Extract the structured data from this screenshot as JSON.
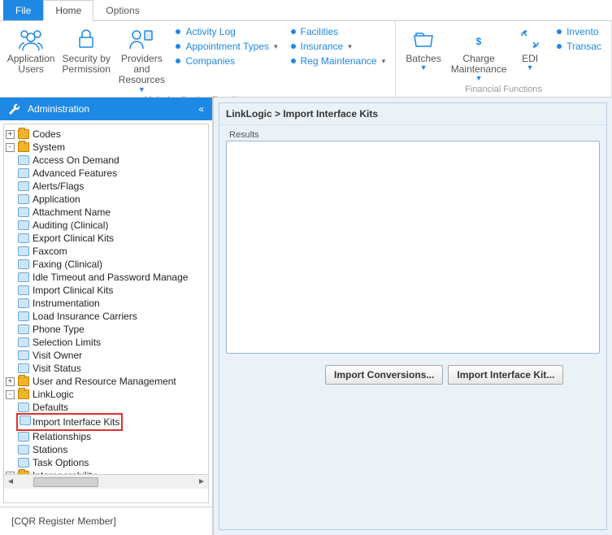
{
  "tabs": {
    "file": "File",
    "home": "Home",
    "options": "Options"
  },
  "ribbon": {
    "main_caption": "Main Application Functions",
    "fin_caption": "Financial Functions",
    "app_users": "Application Users",
    "security": "Security by Permission",
    "providers": "Providers and Resources",
    "activity_log": "Activity Log",
    "appointment_types": "Appointment Types",
    "companies": "Companies",
    "facilities": "Facilities",
    "insurance": "Insurance",
    "reg_maintenance": "Reg Maintenance",
    "batches": "Batches",
    "charge_maint": "Charge Maintenance",
    "edi": "EDI",
    "inventory": "Invento",
    "transactions": "Transac"
  },
  "sidebar": {
    "title": "Administration",
    "footer": "[CQR Register Member]"
  },
  "tree": {
    "codes": "Codes",
    "system": "System",
    "access_on_demand": "Access On Demand",
    "advanced_features": "Advanced Features",
    "alerts_flags": "Alerts/Flags",
    "application": "Application",
    "attachment_name": "Attachment Name",
    "auditing_clinical": "Auditing (Clinical)",
    "export_clinical_kits": "Export Clinical Kits",
    "faxcom": "Faxcom",
    "faxing_clinical": "Faxing (Clinical)",
    "idle_timeout": "Idle Timeout and Password Manage",
    "import_clinical_kits": "Import Clinical Kits",
    "instrumentation": "Instrumentation",
    "load_insurance": "Load Insurance Carriers",
    "phone_type": "Phone Type",
    "selection_limits": "Selection Limits",
    "visit_owner": "Visit Owner",
    "visit_status": "Visit Status",
    "user_resource_mgmt": "User and Resource Management",
    "linklogic": "LinkLogic",
    "defaults": "Defaults",
    "import_interface_kits": "Import Interface Kits",
    "relationships": "Relationships",
    "stations": "Stations",
    "task_options": "Task Options",
    "interoperability": "Interoperability"
  },
  "content": {
    "breadcrumb": "LinkLogic > Import Interface Kits",
    "results_label": "Results",
    "btn_conversions": "Import Conversions...",
    "btn_interface_kit": "Import Interface Kit..."
  }
}
